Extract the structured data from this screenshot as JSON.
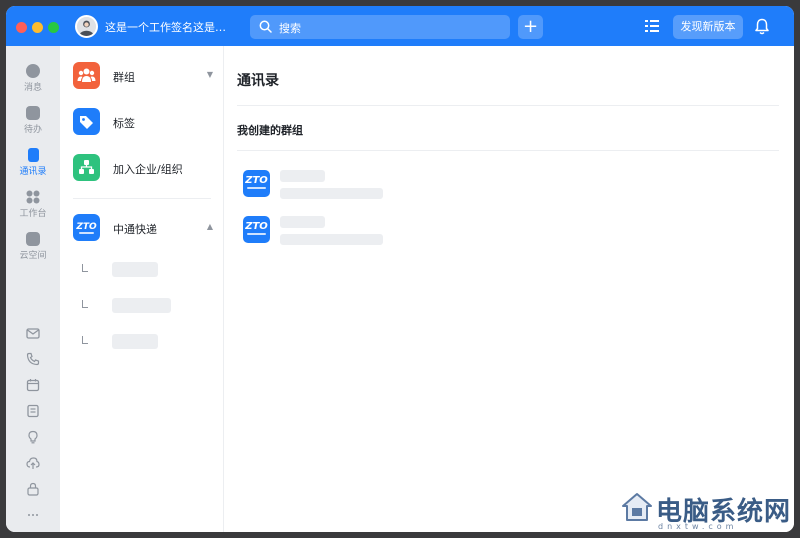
{
  "titlebar": {
    "signature": "这是一个工作签名这是…",
    "search_placeholder": "搜索",
    "add_label": "+",
    "new_version_label": "发现新版本",
    "accent_color": "#1f7dfa"
  },
  "rail": {
    "items": [
      {
        "label": "消息",
        "icon": "message-icon"
      },
      {
        "label": "待办",
        "icon": "todo-icon"
      },
      {
        "label": "通讯录",
        "icon": "contacts-icon",
        "active": true
      },
      {
        "label": "工作台",
        "icon": "workbench-icon"
      },
      {
        "label": "云空间",
        "icon": "cloud-space-icon"
      }
    ],
    "bottom_icons": [
      "mail-icon",
      "phone-icon",
      "calendar-icon",
      "docs-icon",
      "bulb-icon",
      "cloud-upload-icon",
      "share-icon",
      "more-icon"
    ]
  },
  "nav": {
    "groups_label": "群组",
    "tags_label": "标签",
    "join_org_label": "加入企业/组织",
    "org_label": "中通快递",
    "collapse_arrow": "▼",
    "expand_arrow": "▲"
  },
  "main": {
    "title": "通讯录",
    "section_title": "我创建的群组",
    "groups": [
      {
        "logo_text": "ZTO"
      },
      {
        "logo_text": "ZTO"
      }
    ]
  },
  "watermark": {
    "text": "电脑系统网",
    "url": "dnxtw.com"
  }
}
